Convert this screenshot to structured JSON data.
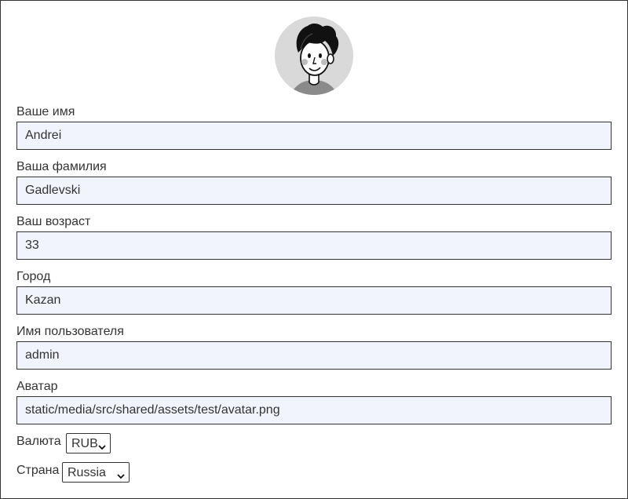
{
  "profile": {
    "avatar_icon": "avatar-image",
    "fields": [
      {
        "label": "Ваше имя",
        "value": "Andrei"
      },
      {
        "label": "Ваша фамилия",
        "value": "Gadlevski"
      },
      {
        "label": "Ваш возраст",
        "value": "33"
      },
      {
        "label": "Город",
        "value": "Kazan"
      },
      {
        "label": "Имя пользователя",
        "value": "admin"
      },
      {
        "label": "Аватар",
        "value": "static/media/src/shared/assets/test/avatar.png"
      }
    ],
    "currency": {
      "label": "Валюта",
      "value": "RUB"
    },
    "country": {
      "label": "Страна",
      "value": "Russia"
    }
  },
  "colors": {
    "input_background": "#f1f4fd",
    "border": "#333333",
    "text": "#333333",
    "avatar_background": "#d9d9d9"
  }
}
